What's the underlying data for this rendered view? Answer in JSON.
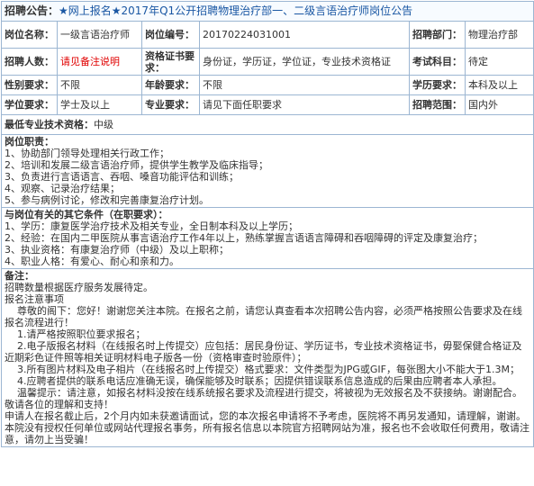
{
  "header": {
    "label": "招聘公告：",
    "value": "★网上报名★2017年Q1公开招聘物理治疗部一、二级言语治疗师岗位公告"
  },
  "row1": {
    "post_name_label": "岗位名称：",
    "post_name": "一级言语治疗师",
    "post_id_label": "岗位编号：",
    "post_id": "20170224031001",
    "dept_label": "招聘部门：",
    "dept": "物理治疗部"
  },
  "row2": {
    "count_label": "招聘人数：",
    "count": "请见备注说明",
    "cert_label": "资格证书要求：",
    "cert": "身份证，学历证，学位证，专业技术资格证",
    "exam_label": "考试科目：",
    "exam": "待定"
  },
  "row3": {
    "gender_label": "性别要求：",
    "gender": "不限",
    "age_label": "年龄要求：",
    "age": "不限",
    "edu_label": "学历要求：",
    "edu": "本科及以上"
  },
  "row4": {
    "degree_label": "学位要求：",
    "degree": "学士及以上",
    "major_label": "专业要求：",
    "major": "请见下面任职要求",
    "scope_label": "招聘范围：",
    "scope": "国内外"
  },
  "row5": {
    "label": "最低专业技术资格：",
    "value": "中级"
  },
  "duties": {
    "title": "岗位职责：",
    "items": [
      "1、协助部门领导处理相关行政工作；",
      "2、培训和发展二级言语治疗师，提供学生教学及临床指导；",
      "3、负责进行言语语言、吞咽、嗓音功能评估和训练；",
      "4、观察、记录治疗结果；",
      "5、参与病例讨论，修改和完善康复治疗计划。"
    ]
  },
  "conditions": {
    "title": "与岗位有关的其它条件（在职要求）：",
    "items": [
      "1、学历：康复医学治疗技术及相关专业，全日制本科及以上学历；",
      "2、经验：在国内二甲医院从事言语治疗工作4年以上，熟练掌握言语语言障碍和吞咽障碍的评定及康复治疗；",
      "3、执业资格：有康复治疗师（中级）及以上职称；",
      "4、职业人格：有爱心、耐心和亲和力。"
    ]
  },
  "notes": {
    "title": "备注：",
    "lines": [
      "招聘数量根据医疗服务发展待定。",
      "报名注意事项",
      "    尊敬的阁下：您好！谢谢您关注本院。在报名之前，请您认真查看本次招聘公告内容，必须严格按照公告要求及在线报名流程进行！",
      "    1.请严格按照职位要求报名；",
      "    2.电子版报名材料（在线报名时上传提交）应包括：居民身份证、学历证书，专业技术资格证书，毋娶保健合格证及近期彩色证件照等相关证明材料电子版各一份（资格审查时验原件）；",
      "    3.所有图片材料及电子相片（在线报名时上传提交）格式要求：文件类型为JPG或GIF，每张图大小不能大于1.3M；",
      "    4.应聘者提供的联系电话应准确无误，确保能够及时联系；因提供错误联系信息造成的后果由应聘者本人承担。",
      "    温馨提示：请注意，如报名材料没按在线系统报名要求及流程进行提交，将被视为无效报名及不获接纳。谢谢配合。敬请各位的理解和支持！",
      "申请人在报名截止后，2个月内如未获邀请面试，您的本次报名申请将不予考虑，医院将不再另发通知，请理解，谢谢。",
      "本院没有授权任何单位或网站代理报名事务，所有报名信息以本院官方招聘网站为准，报名也不会收取任何费用，敬请注意，请勿上当受骗！"
    ]
  },
  "colors": {
    "border": "#9cb6d2",
    "title_blue": "#1a57a3",
    "alert_red": "#e00000"
  }
}
